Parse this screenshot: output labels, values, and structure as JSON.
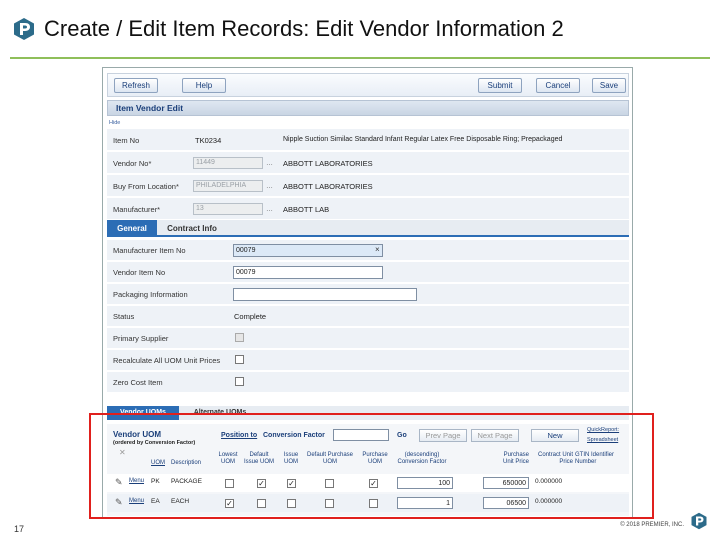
{
  "slide": {
    "title": "Create / Edit Item Records: Edit Vendor Information 2",
    "number": "17",
    "copyright": "© 2018 PREMIER, INC.",
    "accent_color": "#8fbf5a",
    "highlight_color": "#e0201d"
  },
  "toolbar": {
    "refresh": "Refresh",
    "help": "Help",
    "submit": "Submit",
    "cancel": "Cancel",
    "save": "Save"
  },
  "section": {
    "title": "Item Vendor Edit",
    "hide": "Hide"
  },
  "header_fields": [
    {
      "label": "Item No",
      "value": "TK0234",
      "description": "Nipple Suction Similac Standard Infant Regular Latex Free Disposable Ring; Prepackaged"
    },
    {
      "label": "Vendor No*",
      "value": "11449",
      "description": "ABBOTT LABORATORIES"
    },
    {
      "label": "Buy From Location*",
      "value": "PHILADELPHIA",
      "description": "ABBOTT LABORATORIES"
    },
    {
      "label": "Manufacturer*",
      "value": "13",
      "description": "ABBOTT LAB"
    }
  ],
  "tabs": {
    "general": "General",
    "contract": "Contract Info"
  },
  "general": {
    "manufacturer_item_no": {
      "label": "Manufacturer Item No",
      "value": "00079"
    },
    "vendor_item_no": {
      "label": "Vendor Item No",
      "value": "00079"
    },
    "packaging_info": {
      "label": "Packaging Information",
      "value": ""
    },
    "status": {
      "label": "Status",
      "value": "Complete"
    },
    "primary_supplier": {
      "label": "Primary Supplier"
    },
    "recalc_uom": {
      "label": "Recalculate All UOM Unit Prices"
    },
    "zero_cost": {
      "label": "Zero Cost Item"
    }
  },
  "uom": {
    "tab_vendor": "Vendor UOMs",
    "tab_alternate": "Alternate UOMs",
    "title": "Vendor UOM",
    "subtitle": "(ordered by Conversion Factor)",
    "position_to": "Position to",
    "position_label": "Conversion Factor",
    "go": "Go",
    "prev_page": "Prev Page",
    "next_page": "Next Page",
    "new": "New",
    "quick_report": "QuickReport:",
    "spreadsheet": "Spreadsheet",
    "columns": {
      "uom": "UOM",
      "description": "Description",
      "lowest_uom": "Lowest UOM",
      "default_issue": "Default Issue UOM",
      "issue_uom": "Issue UOM",
      "default_purchase": "Default Purchase UOM",
      "purchase_uom": "Purchase UOM",
      "conversion": "(descending) Conversion Factor",
      "unit_price": "Purchase Unit Price",
      "contract_price": "Contract Unit Price",
      "gtin": "GTIN Identifier Number"
    },
    "rows": [
      {
        "menu": "Menu",
        "uom": "PK",
        "description": "PACKAGE",
        "conversion": "100",
        "unit_price": "650000",
        "contract_price": "0.000000"
      },
      {
        "menu": "Menu",
        "uom": "EA",
        "description": "EACH",
        "conversion": "1",
        "unit_price": "06500",
        "contract_price": "0.000000"
      }
    ]
  }
}
